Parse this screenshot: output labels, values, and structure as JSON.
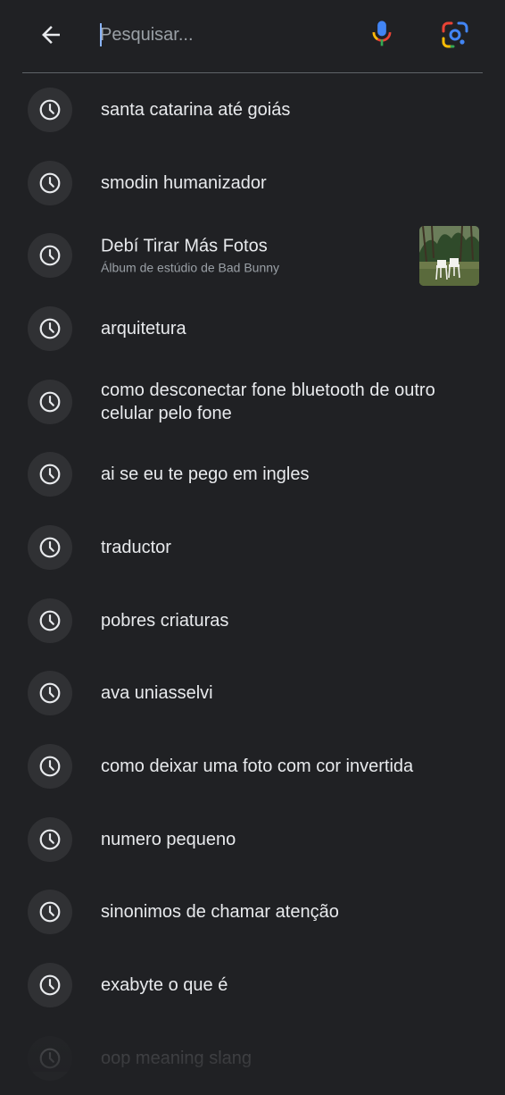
{
  "search": {
    "placeholder": "Pesquisar...",
    "value": ""
  },
  "icons": {
    "back": "arrow-back-icon",
    "mic": "microphone-icon",
    "lens": "google-lens-icon",
    "history": "clock-history-icon"
  },
  "colors": {
    "background": "#202124",
    "text": "#e8eaed",
    "secondary_text": "#9aa0a6",
    "caret": "#8ab4f8",
    "google_blue": "#4285F4",
    "google_red": "#EA4335",
    "google_yellow": "#FBBC05",
    "google_green": "#34A853"
  },
  "history": [
    {
      "label": "santa catarina até goiás"
    },
    {
      "label": "smodin humanizador"
    },
    {
      "label": "Debí Tirar Más Fotos",
      "subtitle": "Álbum de estúdio de Bad Bunny"
    },
    {
      "label": "arquitetura"
    },
    {
      "label": "como desconectar fone bluetooth de outro celular pelo fone"
    },
    {
      "label": "ai se eu te pego em ingles"
    },
    {
      "label": "traductor"
    },
    {
      "label": "pobres criaturas"
    },
    {
      "label": "ava uniasselvi"
    },
    {
      "label": "como deixar uma foto com cor invertida"
    },
    {
      "label": "numero pequeno"
    },
    {
      "label": "sinonimos de chamar atenção"
    },
    {
      "label": "exabyte o que é"
    },
    {
      "label": "oop meaning slang"
    }
  ]
}
